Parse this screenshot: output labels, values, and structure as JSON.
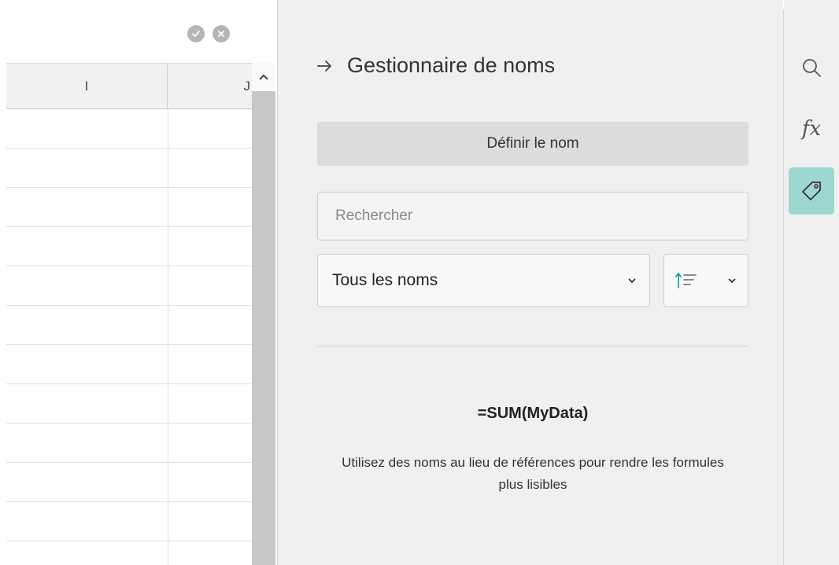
{
  "sheet": {
    "columns": [
      "I",
      "J"
    ],
    "row_count": 12
  },
  "names_panel": {
    "title": "Gestionnaire de noms",
    "define_name_button": "Définir le nom",
    "search": {
      "placeholder": "Rechercher",
      "value": ""
    },
    "filter_select": {
      "selected": "Tous les noms"
    },
    "empty_state": {
      "formula_example": "=SUM(MyData)",
      "description": "Utilisez des noms au lieu de références pour rendre les formules plus lisibles"
    }
  },
  "sidebar_rail": {
    "items": [
      {
        "icon": "search-icon",
        "active": false
      },
      {
        "icon": "function-icon",
        "label": "fx",
        "active": false
      },
      {
        "icon": "tag-icon",
        "active": true
      }
    ]
  },
  "colors": {
    "accent": "#00a18e",
    "active_rail_bg": "#9ed7cf",
    "panel_bg": "#f0f0f0"
  }
}
